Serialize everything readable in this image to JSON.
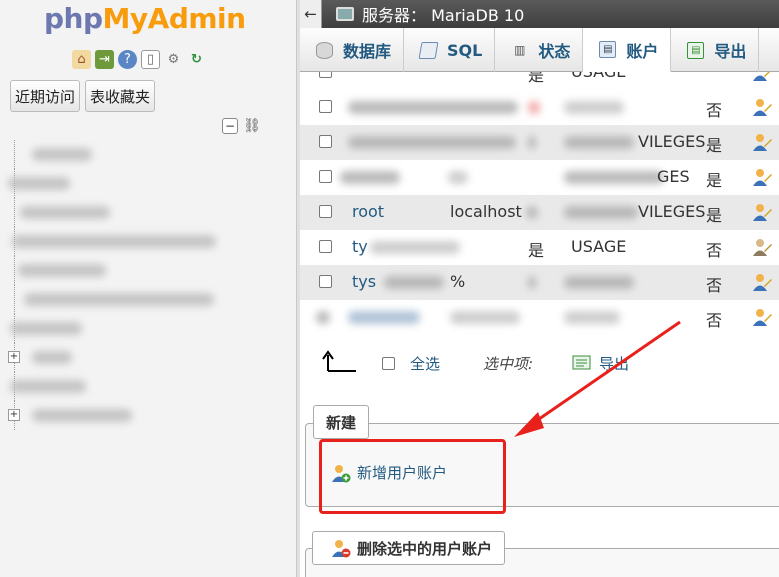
{
  "logo": {
    "prefix": "php",
    "suffix": "MyAdmin"
  },
  "nav": {
    "icons": [
      "home-icon",
      "exit-icon",
      "help-icon",
      "docs-icon",
      "settings-icon",
      "reload-icon"
    ],
    "recent_label": "近期访问",
    "favorites_label": "表收藏夹"
  },
  "topbar": {
    "server_label": "服务器：  MariaDB 10"
  },
  "tabs": [
    {
      "label": "数据库",
      "icon": "database-icon",
      "active": false
    },
    {
      "label": "SQL",
      "icon": "sql-icon",
      "active": false
    },
    {
      "label": "状态",
      "icon": "status-icon",
      "active": false
    },
    {
      "label": "账户",
      "icon": "accounts-icon",
      "active": true
    },
    {
      "label": "导出",
      "icon": "export-icon",
      "active": false
    }
  ],
  "users": [
    {
      "user": "",
      "host": "",
      "password": "是",
      "privileges": "USAGE",
      "grant": "",
      "alt": false
    },
    {
      "user": "",
      "host": "",
      "password": "",
      "privileges": "",
      "grant": "否",
      "alt": false
    },
    {
      "user": "",
      "host": "",
      "password": "",
      "privileges": "VILEGES",
      "grant": "是",
      "alt": true
    },
    {
      "user": "",
      "host": "",
      "password": "",
      "privileges": "GES",
      "grant": "是",
      "alt": false
    },
    {
      "user": "root",
      "host": "localhost",
      "password": "",
      "privileges": "VILEGES",
      "grant": "是",
      "alt": true
    },
    {
      "user": "ty",
      "host": "",
      "password": "是",
      "privileges": "USAGE",
      "grant": "否",
      "alt": false
    },
    {
      "user": "tys",
      "host": "%",
      "password": "",
      "privileges": "",
      "grant": "否",
      "alt": true
    },
    {
      "user": "",
      "host": "",
      "password": "",
      "privileges": "",
      "grant": "否",
      "alt": false
    }
  ],
  "selection": {
    "select_all": "全选",
    "with_selected": "选中项:",
    "export": "导出"
  },
  "new_section": {
    "legend": "新建",
    "add_user": "新增用户账户"
  },
  "delete_section": {
    "button": "删除选中的用户账户"
  },
  "colors": {
    "link": "#235a81",
    "highlight": "#e8211c",
    "logo_php": "#6c78af",
    "logo_admin": "#f89c0e"
  }
}
